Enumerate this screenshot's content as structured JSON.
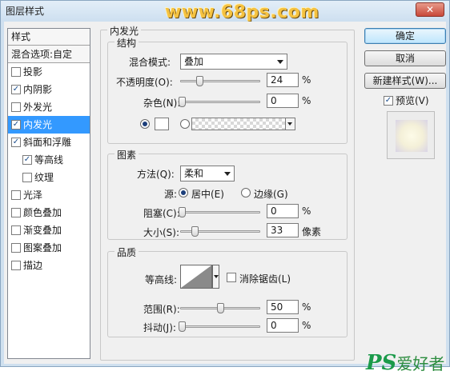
{
  "window": {
    "title": "图层样式",
    "close_label": "✕"
  },
  "watermark": {
    "top": "www.68ps.com",
    "bottom_ps": "PS",
    "bottom_cn": "爱好者"
  },
  "stylelist": {
    "header": "样式",
    "blend_options": "混合选项:自定",
    "items": [
      {
        "label": "投影",
        "checked": false
      },
      {
        "label": "内阴影",
        "checked": true
      },
      {
        "label": "外发光",
        "checked": false
      },
      {
        "label": "内发光",
        "checked": true
      },
      {
        "label": "斜面和浮雕",
        "checked": true
      },
      {
        "label": "等高线",
        "checked": true
      },
      {
        "label": "纹理",
        "checked": false
      },
      {
        "label": "光泽",
        "checked": false
      },
      {
        "label": "颜色叠加",
        "checked": false
      },
      {
        "label": "渐变叠加",
        "checked": false
      },
      {
        "label": "图案叠加",
        "checked": false
      },
      {
        "label": "描边",
        "checked": false
      }
    ]
  },
  "panel": {
    "title": "内发光",
    "structure": {
      "title": "结构",
      "blend_mode_label": "混合模式:",
      "blend_mode_value": "叠加",
      "opacity_label": "不透明度(O):",
      "opacity_value": "24",
      "noise_label": "杂色(N):",
      "noise_value": "0",
      "percent": "%"
    },
    "elements": {
      "title": "图素",
      "method_label": "方法(Q):",
      "method_value": "柔和",
      "source_label": "源:",
      "source_center": "居中(E)",
      "source_edge": "边缘(G)",
      "choke_label": "阻塞(C):",
      "choke_value": "0",
      "size_label": "大小(S):",
      "size_value": "33",
      "px": "像素",
      "percent": "%"
    },
    "quality": {
      "title": "品质",
      "contour_label": "等高线:",
      "antialias_label": "消除锯齿(L)",
      "range_label": "范围(R):",
      "range_value": "50",
      "jitter_label": "抖动(J):",
      "jitter_value": "0",
      "percent": "%"
    }
  },
  "buttons": {
    "ok": "确定",
    "cancel": "取消",
    "new_style": "新建样式(W)...",
    "preview": "预览(V)"
  }
}
